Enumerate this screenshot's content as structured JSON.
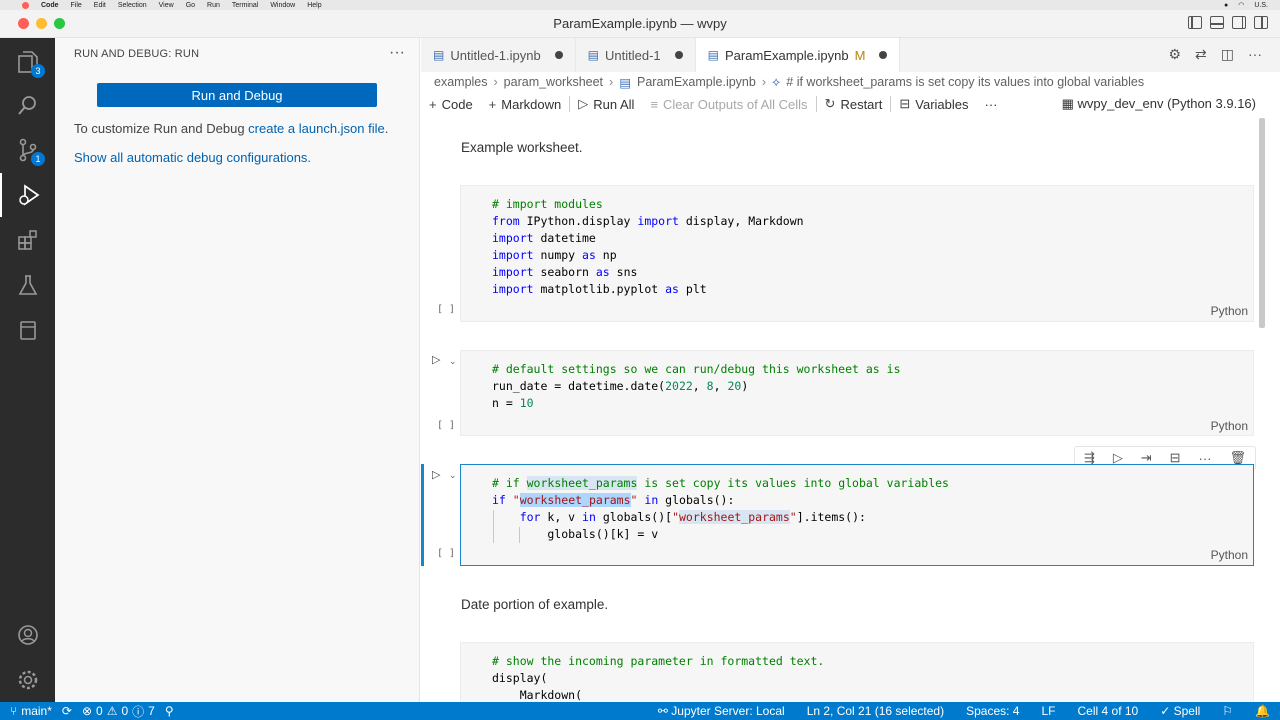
{
  "menubar": {
    "app": "Code",
    "items": [
      "File",
      "Edit",
      "Selection",
      "View",
      "Go",
      "Run",
      "Terminal",
      "Window",
      "Help"
    ],
    "locale": "U.S."
  },
  "window": {
    "title": "ParamExample.ipynb — wvpy"
  },
  "activity": {
    "explorer_badge": "3",
    "scm_badge": "1"
  },
  "sidebar": {
    "header": "RUN AND DEBUG: RUN",
    "run_button": "Run and Debug",
    "desc_prefix": "To customize Run and Debug ",
    "desc_link": "create a launch.json file",
    "desc_suffix": ".",
    "show_link": "Show all automatic debug configurations."
  },
  "tabs": [
    {
      "label": "Untitled-1.ipynb"
    },
    {
      "label": "Untitled-1"
    },
    {
      "label": "ParamExample.ipynb",
      "modified": "M"
    }
  ],
  "breadcrumb": {
    "part1": "examples",
    "part2": "param_worksheet",
    "part3": "ParamExample.ipynb",
    "part4": "# if worksheet_params is set copy its values into global variables"
  },
  "toolbar": {
    "code": "Code",
    "markdown": "Markdown",
    "run_all": "Run All",
    "clear": "Clear Outputs of All Cells",
    "restart": "Restart",
    "variables": "Variables",
    "more": "···",
    "kernel": "wvpy_dev_env (Python 3.9.16)"
  },
  "notebook": {
    "md1": "Example worksheet.",
    "md2": "Date portion of example.",
    "exec_label": "[ ]",
    "lang": "Python",
    "cell1": [
      "# import modules",
      "from IPython.display import display, Markdown",
      "import datetime",
      "import numpy as np",
      "import seaborn as sns",
      "import matplotlib.pyplot as plt"
    ],
    "cell2": [
      "# default settings so we can run/debug this worksheet as is",
      "run_date = datetime.date(2022, 8, 20)",
      "n = 10"
    ],
    "cell3": [
      "# if worksheet_params is set copy its values into global variables",
      "if \"worksheet_params\" in globals():",
      "for k, v in globals()[\"worksheet_params\"].items():",
      "globals()[k] = v"
    ],
    "cell4": [
      "# show the incoming parameter in formatted text.",
      "display(",
      "Markdown("
    ]
  },
  "status": {
    "branch": "main*",
    "errors": "0",
    "warnings": "0",
    "infos": "7",
    "jupyter": "Jupyter Server: Local",
    "position": "Ln 2, Col 21 (16 selected)",
    "spaces": "Spaces: 4",
    "eol": "LF",
    "cell": "Cell 4 of 10",
    "spell": "Spell"
  },
  "colors": {
    "accent": "#007acc",
    "button": "#0069bd",
    "activity_bg": "#2c2c2c"
  }
}
